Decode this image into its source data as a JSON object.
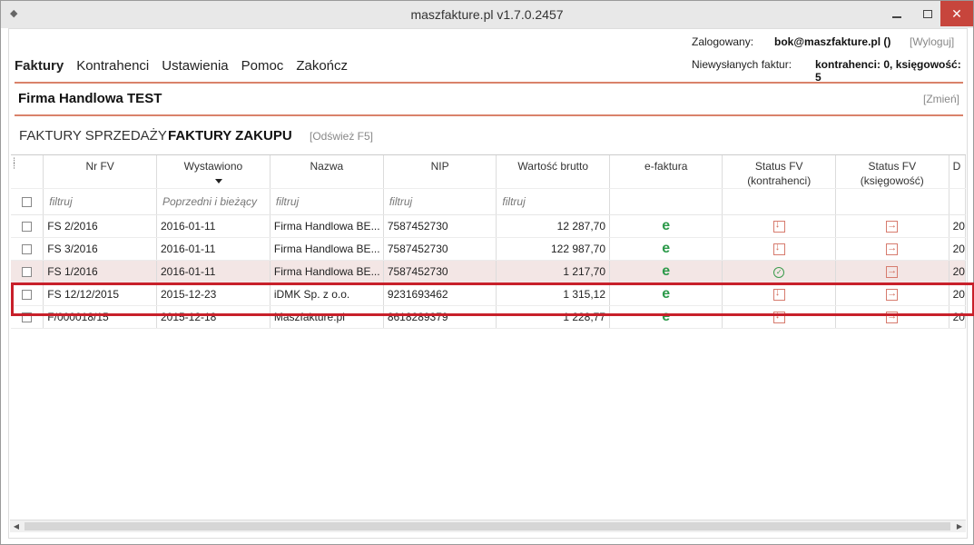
{
  "window": {
    "title": "maszfakture.pl   v1.7.0.2457",
    "app_icon": "gamepad-icon",
    "minimize": "minimize-icon",
    "maximize": "maximize-icon",
    "close": "✕"
  },
  "header": {
    "login_label": "Zalogowany:",
    "login_user": "bok@maszfakture.pl ()",
    "logout": "[Wyloguj]",
    "unsent_label": "Niewysłanych faktur:",
    "unsent_value": "kontrahenci: 0, księgowość: 5"
  },
  "menu": {
    "items": [
      "Faktury",
      "Kontrahenci",
      "Ustawienia",
      "Pomoc",
      "Zakończ"
    ],
    "active": "Faktury"
  },
  "company": {
    "name": "Firma Handlowa TEST",
    "change": "[Zmień]"
  },
  "subtabs": {
    "sales": "FAKTURY SPRZEDAŻY",
    "purchases": "FAKTURY ZAKUPU",
    "refresh": "[Odśwież F5]"
  },
  "table": {
    "columns": {
      "nr": "Nr FV",
      "date": "Wystawiono",
      "name": "Nazwa",
      "nip": "NIP",
      "value": "Wartość brutto",
      "efak": "e-faktura",
      "status_k1": "Status FV",
      "status_k2": "(kontrahenci)",
      "status_b1": "Status FV",
      "status_b2": "(księgowość)",
      "extra": "D"
    },
    "filters": {
      "nr": "filtruj",
      "date": "Poprzedni i bieżący",
      "name": "filtruj",
      "nip": "filtruj",
      "value": "filtruj"
    },
    "rows": [
      {
        "nr": "FS 2/2016",
        "date": "2016-01-11",
        "name": "Firma Handlowa BE...",
        "nip": "7587452730",
        "value": "12 287,70",
        "efak": "e",
        "status_k": "download-icon",
        "status_b": "export-icon",
        "extra": "20"
      },
      {
        "nr": "FS 3/2016",
        "date": "2016-01-11",
        "name": "Firma Handlowa BE...",
        "nip": "7587452730",
        "value": "122 987,70",
        "efak": "e",
        "status_k": "download-icon",
        "status_b": "export-icon",
        "extra": "20"
      },
      {
        "nr": "FS 1/2016",
        "date": "2016-01-11",
        "name": "Firma Handlowa BE...",
        "nip": "7587452730",
        "value": "1 217,70",
        "efak": "e",
        "status_k": "check-circle-icon",
        "status_b": "export-icon",
        "extra": "20"
      },
      {
        "nr": "FS 12/12/2015",
        "date": "2015-12-23",
        "name": "iDMK Sp. z o.o.",
        "nip": "9231693462",
        "value": "1 315,12",
        "efak": "e",
        "status_k": "download-icon",
        "status_b": "export-icon",
        "extra": "20"
      },
      {
        "nr": "F/000018/15",
        "date": "2015-12-18",
        "name": "Maszfakture.pl",
        "nip": "8618289379",
        "value": "1 228,77",
        "efak": "e",
        "status_k": "download-icon",
        "status_b": "export-icon",
        "extra": "20"
      }
    ]
  },
  "colors": {
    "accent": "#d9826a",
    "highlight": "#c8202a",
    "efaktura": "#2c9a4a",
    "close_button": "#c7453c"
  }
}
